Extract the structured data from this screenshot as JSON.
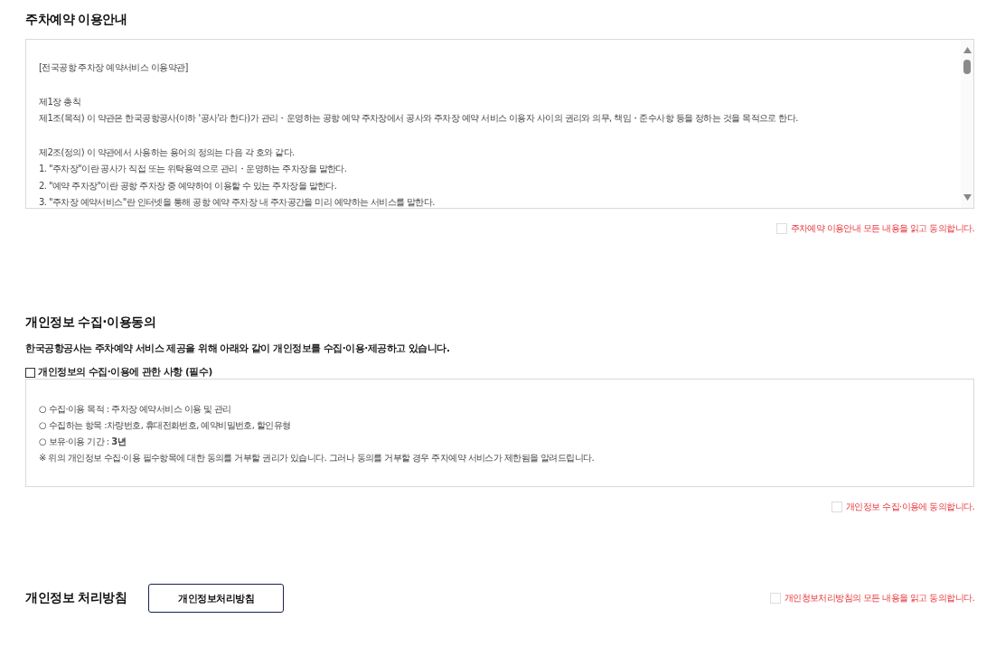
{
  "terms": {
    "title": "주차예약 이용안내",
    "paragraphs": [
      [
        "[전국공항 주차장 예약서비스 이용약관]"
      ],
      [
        "제1장 총칙",
        "제1조(목적) 이 약관은 한국공항공사(이하 '공사'라 한다)가 관리・운영하는 공항 예약 주차장에서 공사와 주차장 예약 서비스 이용자 사이의 권리와 의무, 책임・준수사항 등을 정하는 것을 목적으로 한다."
      ],
      [
        "제2조(정의) 이 약관에서 사용하는 용어의 정의는 다음 각 호와 같다.",
        "1. \"주차장\"이란 공사가 직접 또는 위탁용역으로 관리・운영하는 주차장을 말한다.",
        "2. \"예약 주차장\"이란 공항 주차장 중 예약하여 이용할 수 있는 주차장을 말한다.",
        "3. \"주차장 예약서비스\"란 인터넷을 통해 공항 예약 주차장 내 주차공간을 미리 예약하는 서비스를 말한다."
      ]
    ],
    "agree": {
      "label": "주차예약 이용안내 모든 내용을 읽고 동의합니다.",
      "checked": false
    }
  },
  "privacy": {
    "title": "개인정보 수집·이용동의",
    "description": "한국공항공사는 주차예약 서비스 제공을 위해 아래와 같이 개인정보를 수집·이용·제공하고 있습니다.",
    "item_check": {
      "label": "개인정보의 수집·이용에 관한 사항 (필수)",
      "checked": false
    },
    "lines": [
      "○ 수집·이용 목적 : 주차장 예약서비스 이용 및 관리",
      "○ 수집하는 항목 :차량번호, 휴대전화번호, 예약비밀번호, 할인유형",
      "○ 보유·이용 기간 : **3년**",
      "※ 위의 개인정보 수집·이용 필수항목에 대한 동의를 거부할 권리가 있습니다. 그러나 동의를 거부할 경우 주차예약 서비스가 제한됨을 알려드립니다."
    ],
    "agree": {
      "label": "개인정보 수집·이용에 동의합니다.",
      "checked": false
    }
  },
  "policy": {
    "title": "개인정보 처리방침",
    "button": "개인정보처리방침",
    "agree": {
      "label": "개인청보처리방침의 모든 내용을 읽고 동의합니다.",
      "checked": false
    }
  }
}
